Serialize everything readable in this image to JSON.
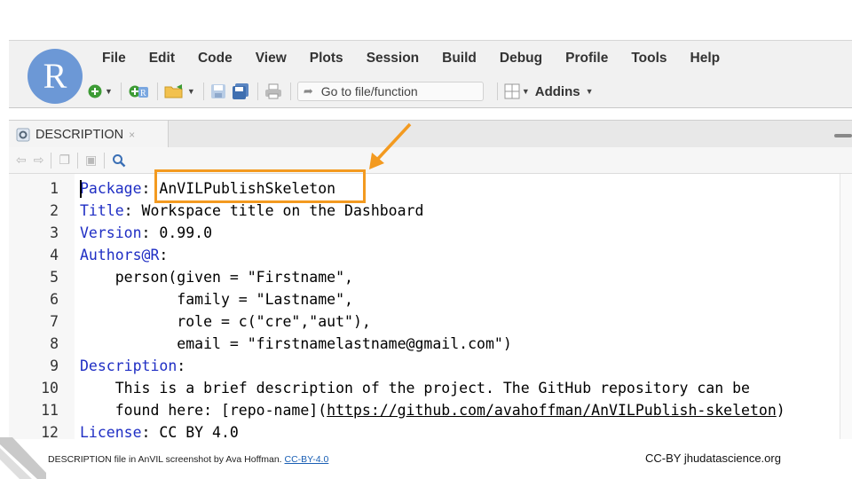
{
  "menu": [
    "File",
    "Edit",
    "Code",
    "View",
    "Plots",
    "Session",
    "Build",
    "Debug",
    "Profile",
    "Tools",
    "Help"
  ],
  "logo": {
    "letter": "R"
  },
  "toolbar": {
    "goto_placeholder": "Go to file/function",
    "addins_label": "Addins"
  },
  "editor_tab": {
    "label": "DESCRIPTION",
    "close": "×"
  },
  "code_lines": [
    {
      "n": "1",
      "parts": [
        {
          "t": "Package",
          "c": "k"
        },
        {
          "t": ": AnVILPublishSkeleton",
          "c": ""
        }
      ]
    },
    {
      "n": "2",
      "parts": [
        {
          "t": "Title",
          "c": "k"
        },
        {
          "t": ": Workspace title on the Dashboard",
          "c": ""
        }
      ]
    },
    {
      "n": "3",
      "parts": [
        {
          "t": "Version",
          "c": "k"
        },
        {
          "t": ": 0.99.0",
          "c": ""
        }
      ]
    },
    {
      "n": "4",
      "parts": [
        {
          "t": "Authors@R",
          "c": "k"
        },
        {
          "t": ":",
          "c": ""
        }
      ]
    },
    {
      "n": "5",
      "parts": [
        {
          "t": "    person(given = \"Firstname\",",
          "c": ""
        }
      ]
    },
    {
      "n": "6",
      "parts": [
        {
          "t": "           family = \"Lastname\",",
          "c": ""
        }
      ]
    },
    {
      "n": "7",
      "parts": [
        {
          "t": "           role = c(\"cre\",\"aut\"),",
          "c": ""
        }
      ]
    },
    {
      "n": "8",
      "parts": [
        {
          "t": "           email = \"firstnamelastname@gmail.com\")",
          "c": ""
        }
      ]
    },
    {
      "n": "9",
      "parts": [
        {
          "t": "Description",
          "c": "k"
        },
        {
          "t": ":",
          "c": ""
        }
      ]
    },
    {
      "n": "10",
      "parts": [
        {
          "t": "    This is a brief description of the project. The GitHub repository can be",
          "c": ""
        }
      ]
    },
    {
      "n": "11",
      "parts": [
        {
          "t": "    found here: [repo-name](",
          "c": ""
        },
        {
          "t": "https://github.com/avahoffman/AnVILPublish-skeleton",
          "c": "u"
        },
        {
          "t": ")",
          "c": ""
        }
      ]
    },
    {
      "n": "12",
      "parts": [
        {
          "t": "License",
          "c": "k"
        },
        {
          "t": ": CC BY 4.0",
          "c": ""
        }
      ]
    }
  ],
  "colors": {
    "highlight": "#f39a20",
    "keyword": "#1f2ec4",
    "logo_bg": "#6c98d6"
  },
  "footer": {
    "caption": "DESCRIPTION file  in AnVIL screenshot by Ava Hoffman. ",
    "license_link": "CC-BY-4.0",
    "credit": "CC-BY  jhudatascience.org"
  }
}
